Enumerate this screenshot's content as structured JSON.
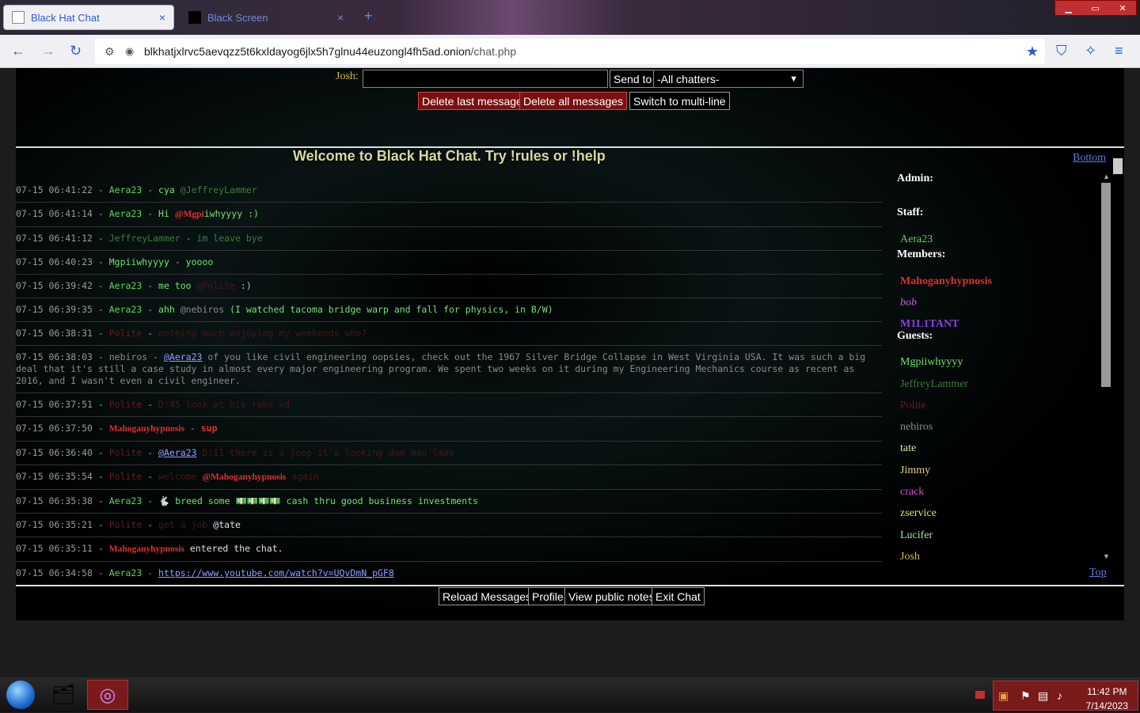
{
  "browser": {
    "tabs": [
      {
        "title": "Black Hat Chat",
        "active": true
      },
      {
        "title": "Black Screen",
        "active": false
      }
    ],
    "new_tab": "+",
    "close_glyph": "×",
    "url_host": "blkhatjxlrvc5aevqzz5t6kxldayog6jlx5h7glnu44euzongl4fh5ad.onion",
    "url_path": "/chat.php"
  },
  "post": {
    "nick_label": "Josh:",
    "message_value": "",
    "send_to_label": "Send to",
    "send_to_selected": "-All chatters-",
    "delete_last_label": "Delete last message",
    "delete_all_label": "Delete all messages",
    "switch_multiline_label": "Switch to multi-line"
  },
  "welcome": "Welcome to Black Hat Chat. Try !rules or !help",
  "nav": {
    "bottom": "Bottom",
    "top": "Top"
  },
  "messages": [
    {
      "ts": "07-15 06:41:22",
      "nick": "Aera23",
      "nick_class": "n-aera",
      "text": "cya ",
      "text_class": "t-aera",
      "extra": "@JeffreyLammer",
      "extra_class": "t-jeff"
    },
    {
      "ts": "07-15 06:41:14",
      "nick": "Aera23",
      "nick_class": "n-aera",
      "text": "Hi ",
      "text_class": "t-aera",
      "mention": "@Mgpi",
      "after": "iwhyyyy :)",
      "after_class": "t-aera"
    },
    {
      "ts": "07-15 06:41:12",
      "nick": "JeffreyLammer",
      "nick_class": "n-jeff",
      "text": "im leave bye",
      "text_class": "t-jeff"
    },
    {
      "ts": "07-15 06:40:23",
      "nick": "Mgpiiwhyyyy",
      "nick_class": "n-mgp",
      "text": "yoooo",
      "text_class": "t-aera"
    },
    {
      "ts": "07-15 06:39:42",
      "nick": "Aera23",
      "nick_class": "n-aera",
      "text": "me too ",
      "text_class": "t-aera",
      "extra": "@Polite",
      "extra_class": "t-polite",
      "after": " :)",
      "after_class": "t-aera"
    },
    {
      "ts": "07-15 06:39:35",
      "nick": "Aera23",
      "nick_class": "n-aera",
      "text": "ahh ",
      "text_class": "t-aera",
      "extra": "@nebiros",
      "extra_class": "t-nebiros",
      "after": " (I watched tacoma bridge warp and fall for physics, in B/W)",
      "after_class": "t-aera"
    },
    {
      "ts": "07-15 06:38:31",
      "nick": "Polite",
      "nick_class": "n-polite",
      "text": "nothing much enjoying my weekends who?",
      "text_class": "t-polite"
    },
    {
      "ts": "07-15 06:38:03",
      "nick": "nebiros",
      "nick_class": "n-nebiros",
      "link": "@Aera23",
      "text": " of you like civil engineering oopsies, check out the 1967 Silver Bridge Collapse in West Virginia USA. It was such a big deal that it's still a case study in almost every major engineering program. We spent two weeks on it during my Engineering Mechanics course as recent as 2016, and I wasn't even a civil engineer.",
      "text_class": "t-nebiros"
    },
    {
      "ts": "07-15 06:37:51",
      "nick": "Polite",
      "nick_class": "n-polite",
      "text": "D:45 look at his rebs xd",
      "text_class": "t-polite"
    },
    {
      "ts": "07-15 06:37:50",
      "nick": "Mahoganyhypnosis",
      "nick_class": "n-mahog",
      "text": "sup",
      "text_class": "t-mahog"
    },
    {
      "ts": "07-15 06:36:40",
      "nick": "Polite",
      "nick_class": "n-polite",
      "link": "@Aera23",
      "text": " D:11 there is a jeep it's looking dam man lmao",
      "text_class": "t-polite"
    },
    {
      "ts": "07-15 06:35:54",
      "nick": "Polite",
      "nick_class": "n-polite",
      "text": "welcome ",
      "text_class": "t-polite",
      "mention": "@Mahoganyhypnosis",
      "after": " again",
      "after_class": "t-polite"
    },
    {
      "ts": "07-15 06:35:38",
      "nick": "Aera23",
      "nick_class": "n-aera",
      "text": "🐇 breed some 💵💵💵💵 cash thru good business investments",
      "text_class": "t-aera"
    },
    {
      "ts": "07-15 06:35:21",
      "nick": "Polite",
      "nick_class": "n-polite",
      "text": "get a job ",
      "text_class": "t-polite",
      "extra": "@tate",
      "extra_class": "t-sys"
    },
    {
      "ts": "07-15 06:35:11",
      "nick": "Mahoganyhypnosis",
      "nick_class": "n-mahog",
      "sys": true,
      "text": " entered the chat.",
      "text_class": "t-sys"
    },
    {
      "ts": "07-15 06:34:58",
      "nick": "Aera23",
      "nick_class": "n-aera",
      "link": "https://www.youtube.com/watch?v=UQvDmN_pGF8",
      "text": "",
      "text_class": "t-aera"
    }
  ],
  "userlist": {
    "admin_label": "Admin:",
    "staff_label": "Staff:",
    "members_label": "Members:",
    "guests_label": "Guests:",
    "staff": [
      {
        "name": "Aera23",
        "color": "#59d659"
      }
    ],
    "members": [
      {
        "name": "Mahoganyhypnosis",
        "color": "#e03030",
        "bold": true
      },
      {
        "name": "bob",
        "color": "#c060e0",
        "italic": true
      },
      {
        "name": "M1L1TANT",
        "color": "#8a40e0",
        "bold": true
      }
    ],
    "guests": [
      {
        "name": "Mgpiiwhyyyy",
        "color": "#72e072"
      },
      {
        "name": "JeffreyLammer",
        "color": "#3e7a3e"
      },
      {
        "name": "Polite",
        "color": "#6a1a1a"
      },
      {
        "name": "nebiros",
        "color": "#8a8a8a"
      },
      {
        "name": "tate",
        "color": "#e0e0a0"
      },
      {
        "name": "Jimmy",
        "color": "#e0d080"
      },
      {
        "name": "crack",
        "color": "#d050d0"
      },
      {
        "name": "zservice",
        "color": "#e0e060"
      },
      {
        "name": "Lucifer",
        "color": "#a0e0a0"
      },
      {
        "name": "Josh",
        "color": "#d8b84a"
      }
    ]
  },
  "footer": {
    "reload_label": "Reload Messages",
    "profile_label": "Profile",
    "notes_label": "View public notes",
    "exit_label": "Exit Chat"
  },
  "taskbar": {
    "time": "11:42 PM",
    "date": "7/14/2023"
  }
}
